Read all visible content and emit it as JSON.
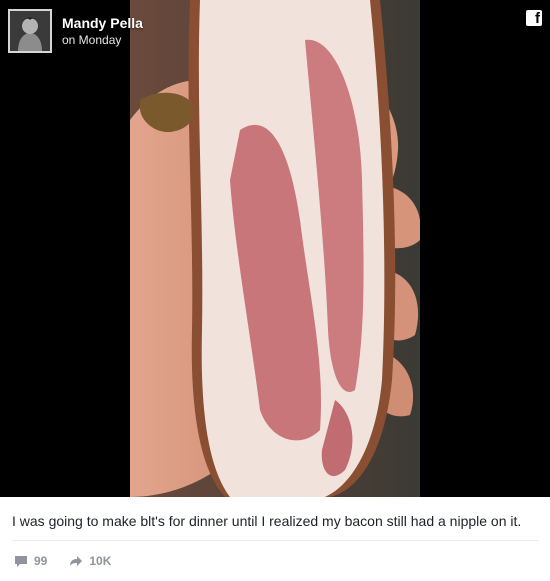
{
  "post": {
    "author": "Mandy Pella",
    "time": "on Monday",
    "platform_icon": "facebook-icon",
    "caption": "I was going to make blt's for dinner until I realized my bacon still had a nipple on it.",
    "stats": {
      "comments": "99",
      "shares": "10K"
    }
  },
  "colors": {
    "media_background": "#000000",
    "caption_text": "#1d2129",
    "stats_text": "#90949c"
  }
}
